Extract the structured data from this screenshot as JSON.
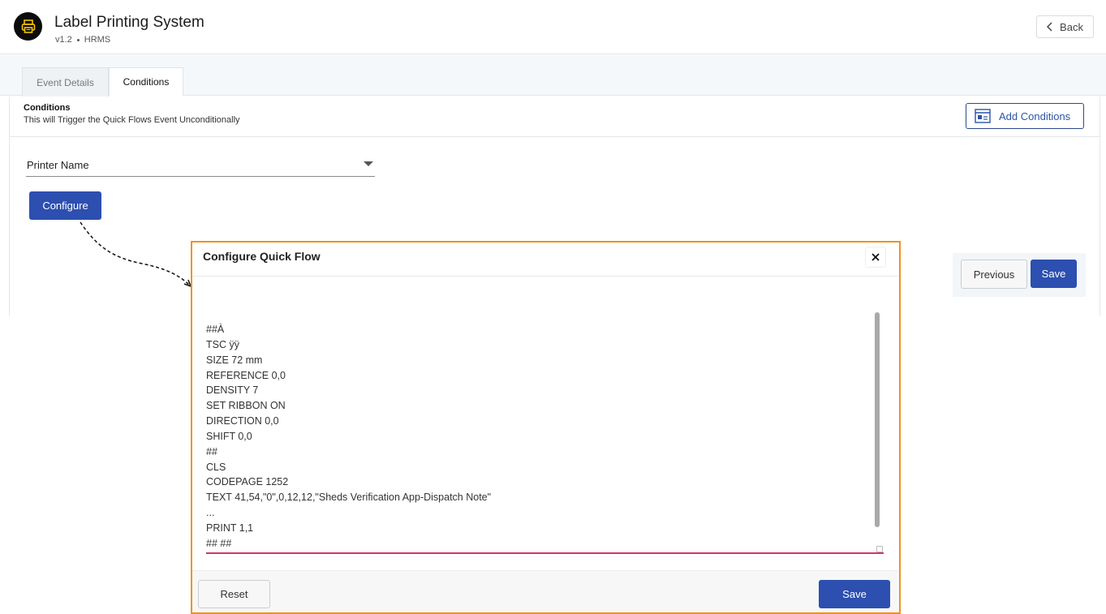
{
  "app": {
    "title": "Label Printing System",
    "version": "v1.2",
    "module": "HRMS",
    "back_label": "Back"
  },
  "tabs": [
    {
      "label": "Event Details",
      "active": false
    },
    {
      "label": "Conditions",
      "active": true
    }
  ],
  "conditions": {
    "title": "Conditions",
    "description": "This will Trigger the Quick Flows Event Unconditionally",
    "add_button_label": "Add Conditions"
  },
  "printer_select": {
    "label": "Printer Name"
  },
  "configure_label": "Configure",
  "actions": {
    "previous_label": "Previous",
    "save_label": "Save"
  },
  "modal": {
    "title": "Configure Quick Flow",
    "code_lines": [
      "##À",
      "TSC ÿÿ",
      "SIZE 72 mm",
      "REFERENCE 0,0",
      "DENSITY 7",
      "SET RIBBON ON",
      "DIRECTION 0,0",
      "SHIFT 0,0",
      "##",
      "CLS",
      "CODEPAGE 1252",
      "TEXT 41,54,\"0\",0,12,12,\"Sheds Verification App-Dispatch Note\"",
      "...",
      "PRINT 1,1",
      "## ##"
    ],
    "reset_label": "Reset",
    "save_label": "Save"
  },
  "colors": {
    "primary": "#2c4fb0",
    "modal_border": "#f0931e",
    "textarea_underline": "#d6336c"
  }
}
